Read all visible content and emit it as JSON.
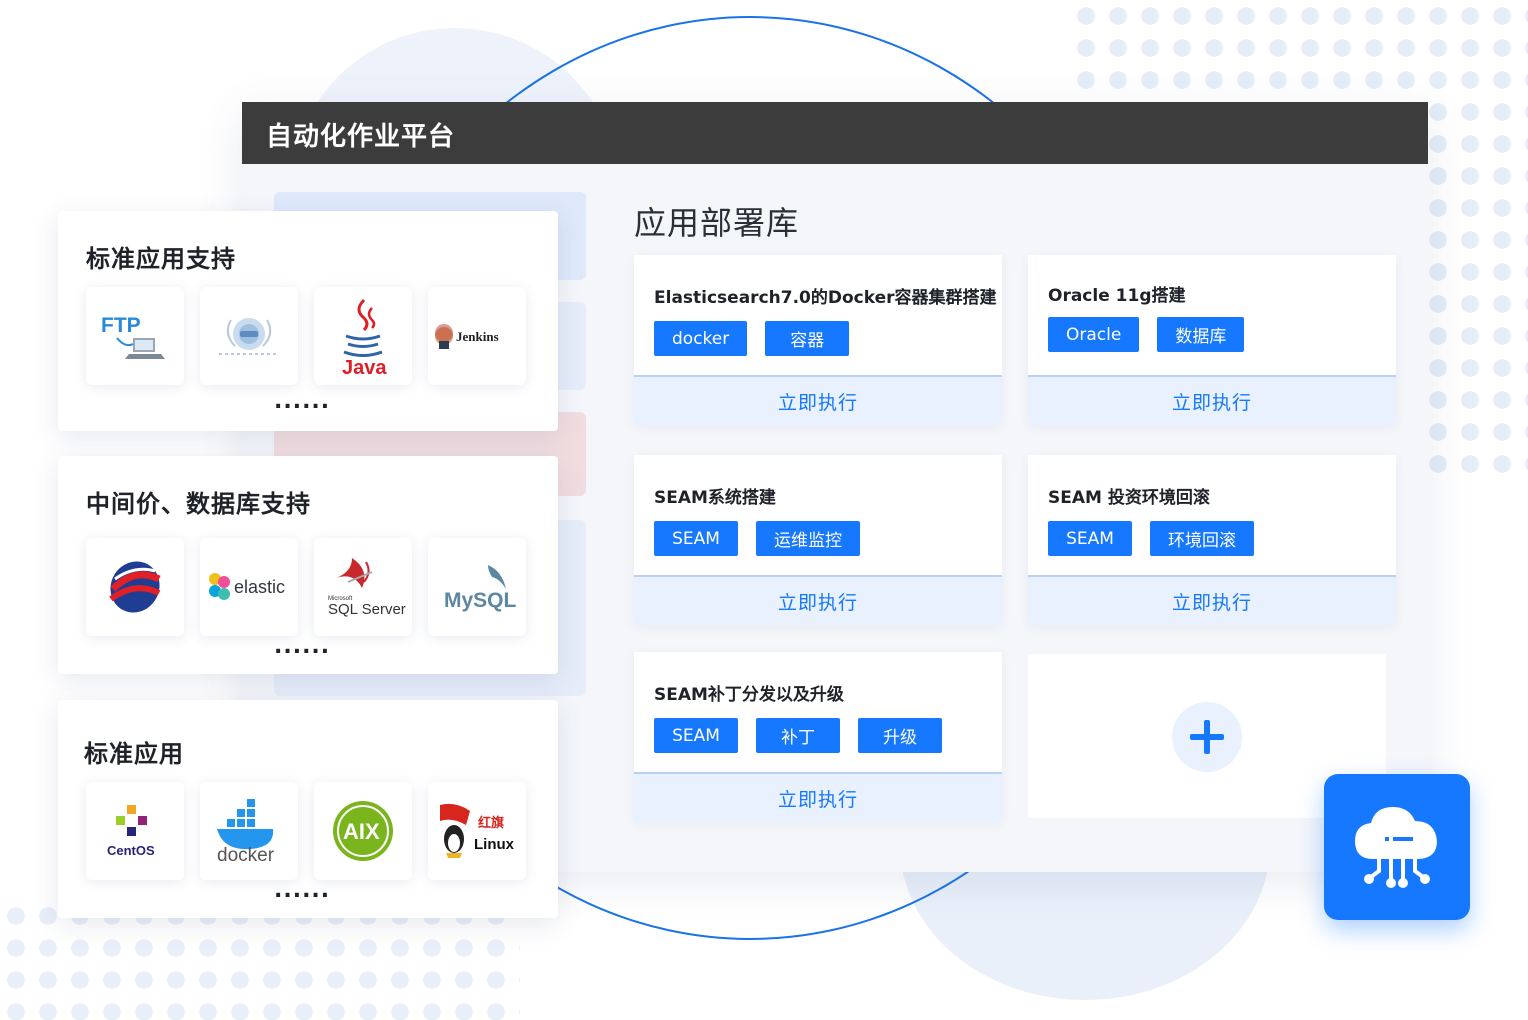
{
  "window": {
    "title": "自动化作业平台"
  },
  "main": {
    "section_title": "应用部署库",
    "cards": [
      {
        "title": "Elasticsearch7.0的Docker容器集群搭建",
        "tags": [
          "docker",
          "容器"
        ],
        "action": "立即执行"
      },
      {
        "title": "Oracle 11g搭建",
        "tags": [
          "Oracle",
          "数据库"
        ],
        "action": "立即执行"
      },
      {
        "title": "SEAM系统搭建",
        "tags": [
          "SEAM",
          "运维监控"
        ],
        "action": "立即执行"
      },
      {
        "title": "SEAM 投资环境回滚",
        "tags": [
          "SEAM",
          "环境回滚"
        ],
        "action": "立即执行"
      },
      {
        "title": "SEAM补丁分发以及升级",
        "tags": [
          "SEAM",
          "补丁",
          "升级"
        ],
        "action": "立即执行"
      }
    ],
    "add_icon": "plus-icon"
  },
  "support_panels": [
    {
      "title": "标准应用支持",
      "logos": [
        {
          "name": "ftp-logo",
          "text": "FTP"
        },
        {
          "name": "http-server-logo",
          "text": ""
        },
        {
          "name": "java-logo",
          "text": "Java"
        },
        {
          "name": "jenkins-logo",
          "text": "Jenkins"
        }
      ],
      "more": "......"
    },
    {
      "title": "中间价、数据库支持",
      "logos": [
        {
          "name": "middleware-logo",
          "text": ""
        },
        {
          "name": "elastic-logo",
          "text": "elastic"
        },
        {
          "name": "sql-server-logo",
          "text": "SQL Server",
          "sub": "Microsoft"
        },
        {
          "name": "mysql-logo",
          "text": "MySQL"
        }
      ],
      "more": "......"
    },
    {
      "title": "标准应用",
      "logos": [
        {
          "name": "centos-logo",
          "text": "CentOS"
        },
        {
          "name": "docker-logo",
          "text": "docker"
        },
        {
          "name": "aix-logo",
          "text": "AIX"
        },
        {
          "name": "redflag-linux-logo",
          "text": "Linux",
          "sub": "红旗"
        }
      ],
      "more": "......"
    }
  ],
  "badge": {
    "icon": "cloud-network-icon"
  },
  "colors": {
    "primary": "#1677ff",
    "header": "#3c3c3c",
    "exec_bg": "#e8f1fd"
  }
}
